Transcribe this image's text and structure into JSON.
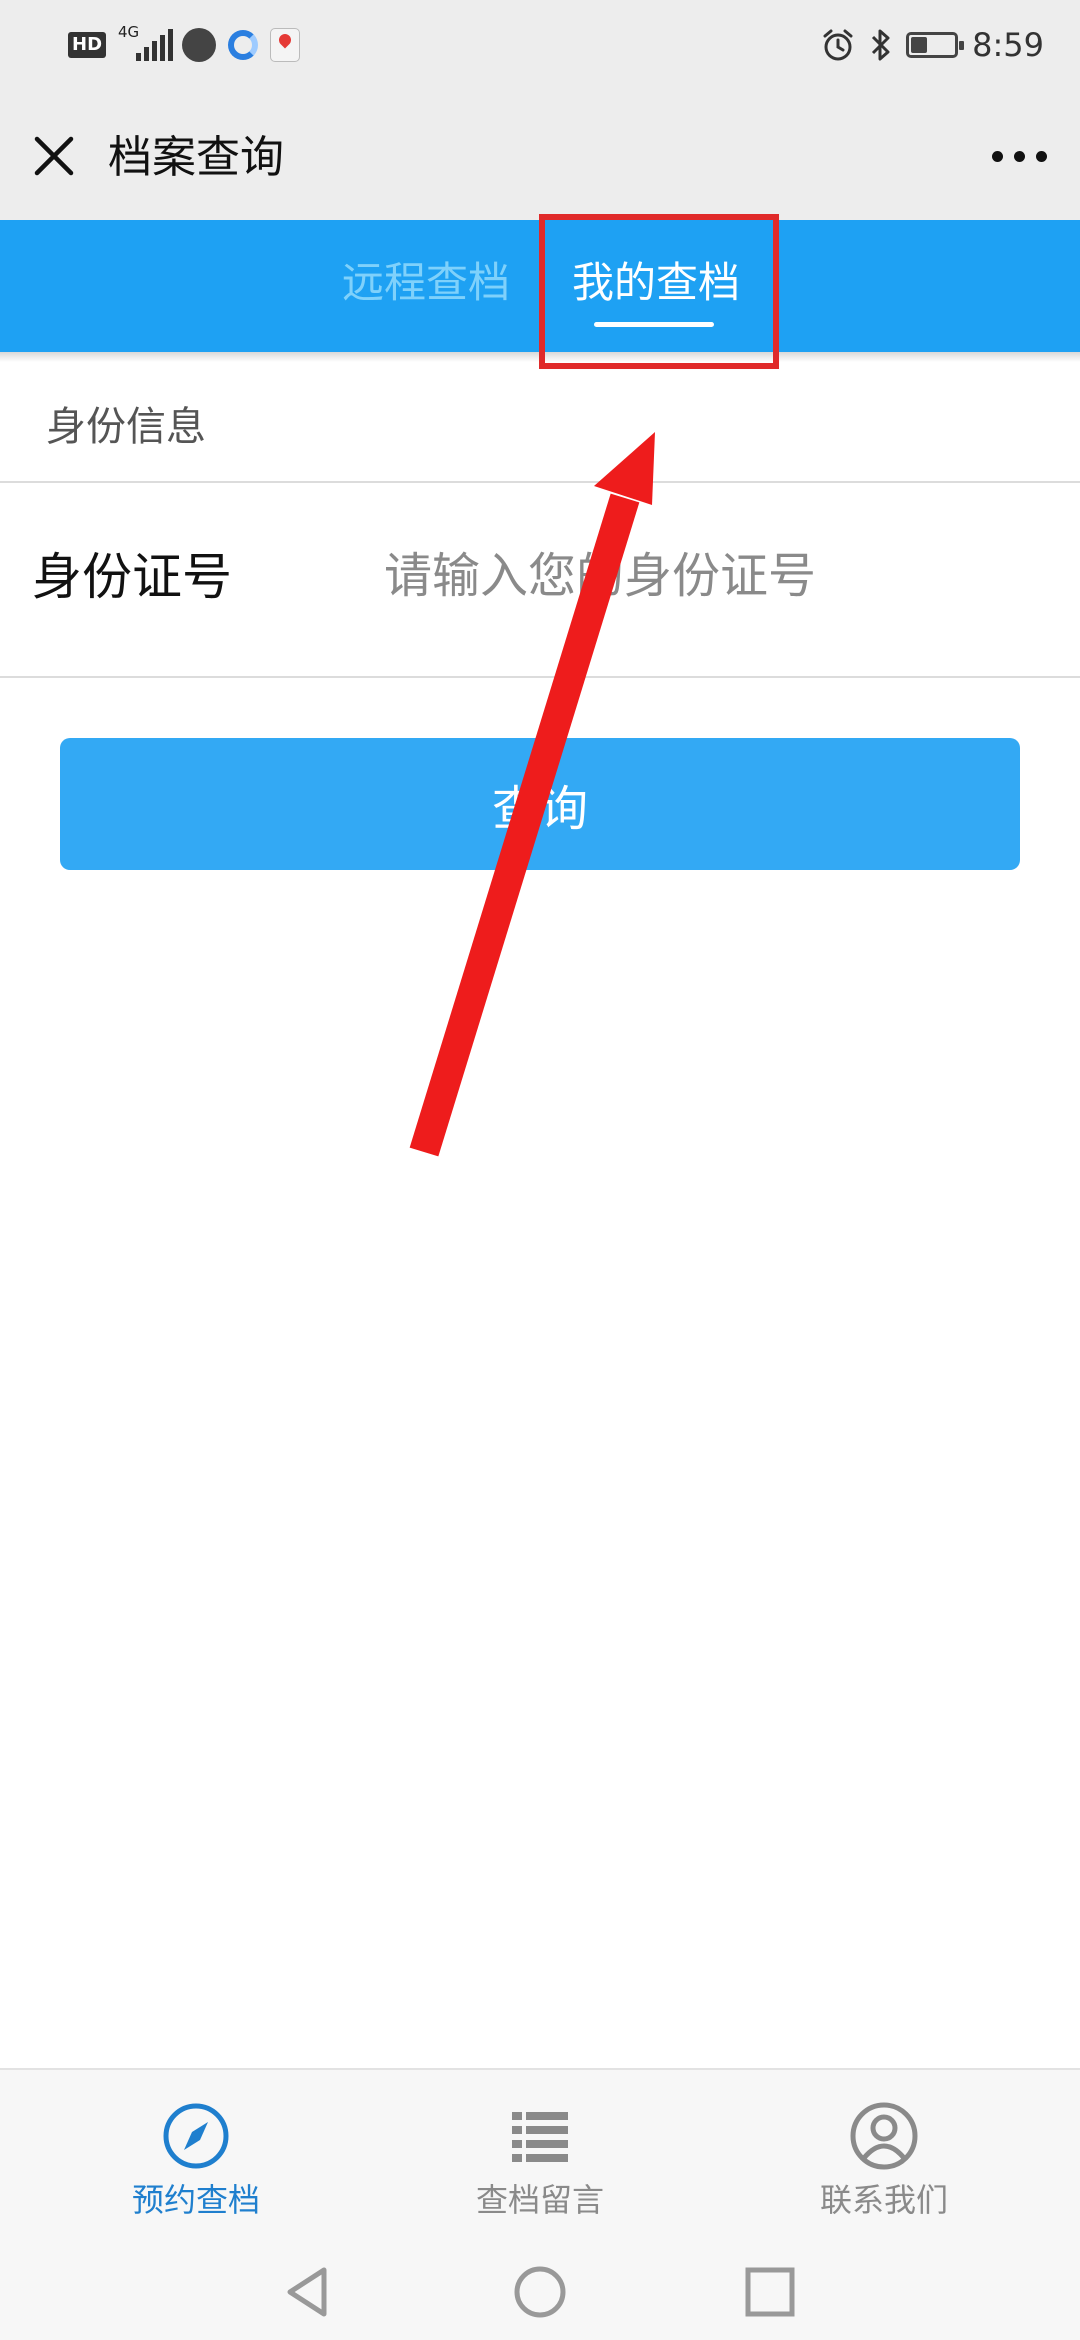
{
  "status_bar": {
    "network_badge": "HD",
    "network_type": "4G",
    "time": "8:59",
    "icons": [
      "hd-badge",
      "signal-icon",
      "globe-icon",
      "ring-app-icon",
      "map-pin-app-icon",
      "alarm-icon",
      "bluetooth-icon",
      "battery-icon"
    ],
    "battery_level": 0.35
  },
  "header": {
    "title": "档案查询",
    "close_icon": "close-icon",
    "more_icon": "more-icon"
  },
  "tabs": [
    {
      "label": "远程查档",
      "active": false
    },
    {
      "label": "我的查档",
      "active": true
    }
  ],
  "form": {
    "section_title": "身份信息",
    "id_label": "身份证号",
    "id_placeholder": "请输入您的身份证号",
    "id_value": "",
    "submit_label": "查询"
  },
  "bottom_nav": [
    {
      "label": "预约查档",
      "icon": "compass-icon",
      "active": true
    },
    {
      "label": "查档留言",
      "icon": "list-icon",
      "active": false
    },
    {
      "label": "联系我们",
      "icon": "user-icon",
      "active": false
    }
  ],
  "system_nav": [
    "back-icon",
    "home-icon",
    "recents-icon"
  ],
  "colors": {
    "tab_bar": "#1ea1f3",
    "tab_inactive_text": "#7fd1fb",
    "primary_button": "#33a9f4",
    "nav_active": "#1f7fce",
    "nav_inactive": "#8a8a8a",
    "annotation": "#e02a2a"
  }
}
